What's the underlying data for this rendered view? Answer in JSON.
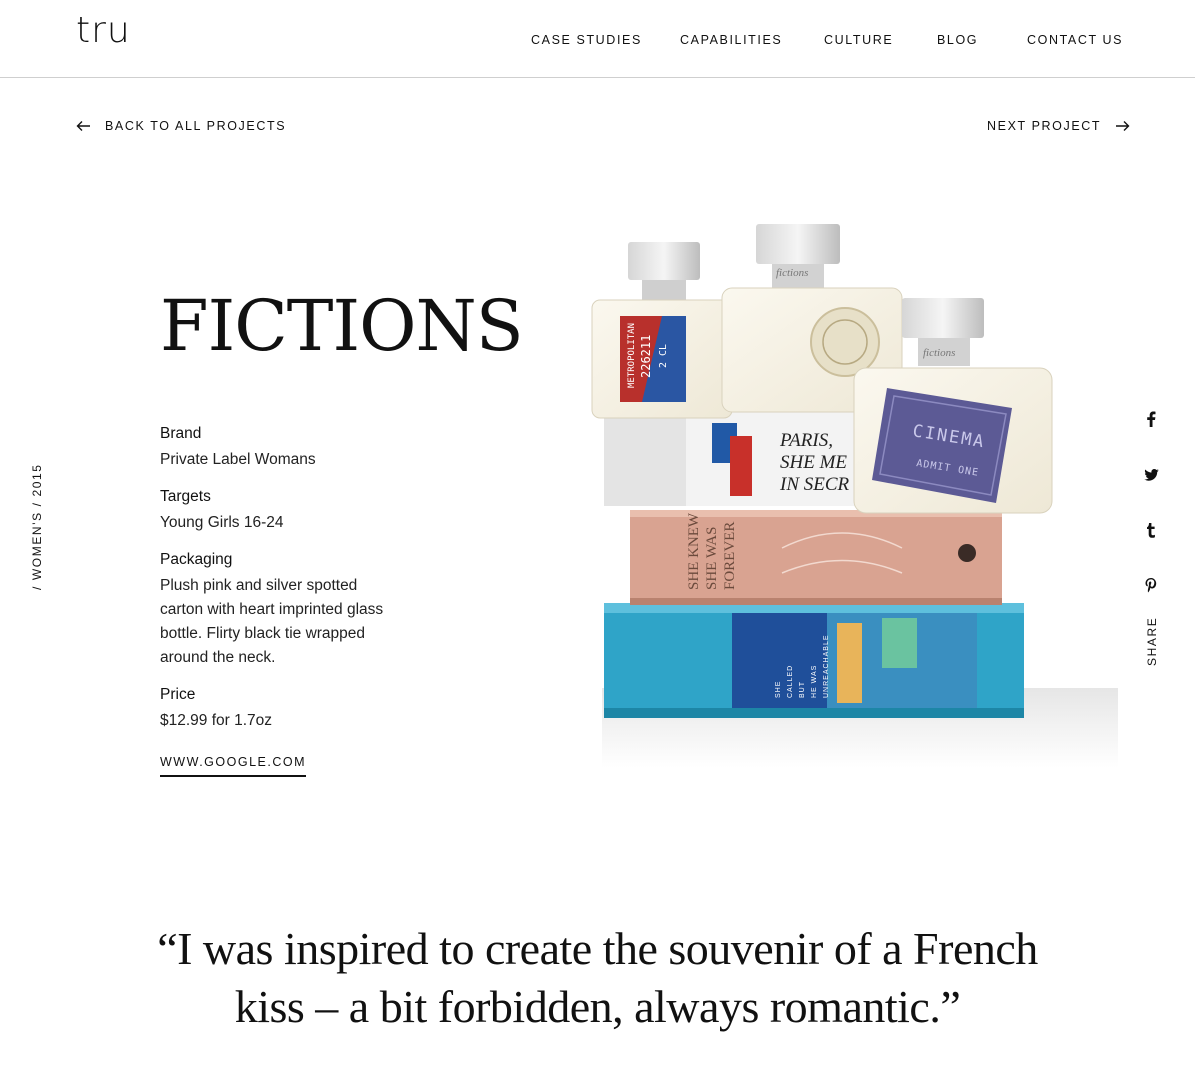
{
  "header": {
    "logo": "tru",
    "nav": [
      "CASE STUDIES",
      "CAPABILITIES",
      "CULTURE",
      "BLOG",
      "CONTACT US"
    ]
  },
  "project_nav": {
    "back_label": "BACK TO ALL PROJECTS",
    "next_label": "NEXT PROJECT"
  },
  "side_category": "/ WOMEN'S / 2015",
  "project": {
    "title": "FICTIONS",
    "details": [
      {
        "label": "Brand",
        "value": "Private Label Womans"
      },
      {
        "label": "Targets",
        "value": "Young Girls 16-24"
      },
      {
        "label": "Packaging",
        "value": "Plush pink and silver spotted carton with heart imprinted glass bottle. Flirty black tie wrapped around the neck."
      },
      {
        "label": "Price",
        "value": "$12.99 for 1.7oz"
      }
    ],
    "link": "WWW.GOOGLE.COM"
  },
  "product_image": {
    "bottle_labels": {
      "metro_line1": "METROPOLITAN",
      "metro_line2": "226211",
      "metro_line3": "2 CL",
      "paris": [
        "PARIS,",
        "SHE ME",
        "IN SECR"
      ],
      "cinema": "CINEMA",
      "admit": "ADMIT ONE",
      "brand": "fictions",
      "pink_box": [
        "SHE KNEW",
        "SHE WAS",
        "FOREVER"
      ],
      "blue_box": [
        "SHE",
        "CALLED",
        "BUT",
        "HE WAS",
        "UNREACHABLE"
      ]
    },
    "colors": {
      "blue_box": "#2fa4c8",
      "pink_box": "#d9a391",
      "white_box": "#f3f3f3",
      "cinema": "#5c5a95",
      "red": "#c8302a"
    }
  },
  "share": {
    "label": "SHARE",
    "icons": [
      "facebook-icon",
      "twitter-icon",
      "tumblr-icon",
      "pinterest-icon"
    ],
    "glyphs": [
      "f",
      "t",
      "t",
      "p"
    ]
  },
  "quote": {
    "line1": "“I was inspired to create the souvenir of a French",
    "line2": "kiss – a bit forbidden, always romantic.”"
  }
}
